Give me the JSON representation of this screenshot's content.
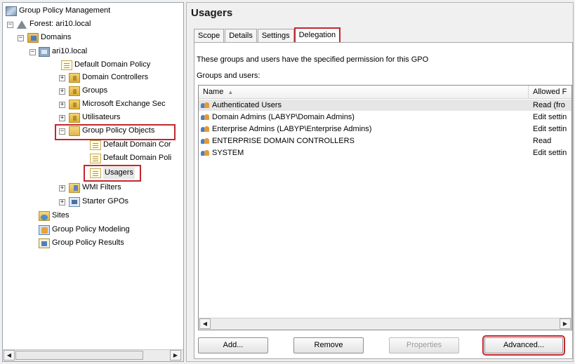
{
  "tree": {
    "items": [
      {
        "label": "Group Policy Management",
        "icon": "gpm-icon",
        "expander": ""
      },
      {
        "label": "Forest: ari10.local",
        "icon": "forest-icon",
        "expander": "−"
      },
      {
        "label": "Domains",
        "icon": "domains-icon",
        "expander": "−"
      },
      {
        "label": "ari10.local",
        "icon": "domain-icon",
        "expander": "−"
      },
      {
        "label": "Default Domain Policy",
        "icon": "gpo-link-icon",
        "expander": ""
      },
      {
        "label": "Domain Controllers",
        "icon": "ou-icon",
        "expander": "+"
      },
      {
        "label": "Groups",
        "icon": "ou-icon",
        "expander": "+"
      },
      {
        "label": "Microsoft Exchange Sec",
        "icon": "ou-icon",
        "expander": "+"
      },
      {
        "label": "Utilisateurs",
        "icon": "ou-icon",
        "expander": "+"
      },
      {
        "label": "Group Policy Objects",
        "icon": "folder-icon",
        "expander": "−"
      },
      {
        "label": "Default Domain Cor",
        "icon": "gpo-icon",
        "expander": ""
      },
      {
        "label": "Default Domain Poli",
        "icon": "gpo-icon",
        "expander": ""
      },
      {
        "label": "Usagers",
        "icon": "gpo-icon",
        "expander": ""
      },
      {
        "label": "WMI Filters",
        "icon": "wmi-filter-icon",
        "expander": "+"
      },
      {
        "label": "Starter GPOs",
        "icon": "starter-gpo-icon",
        "expander": "+"
      },
      {
        "label": "Sites",
        "icon": "sites-icon",
        "expander": ""
      },
      {
        "label": "Group Policy Modeling",
        "icon": "modeling-icon",
        "expander": ""
      },
      {
        "label": "Group Policy Results",
        "icon": "results-icon",
        "expander": ""
      }
    ]
  },
  "gpo": {
    "title": "Usagers",
    "tabs": [
      "Scope",
      "Details",
      "Settings",
      "Delegation"
    ],
    "active_tab": "Delegation",
    "description": "These groups and users have the specified permission for this GPO",
    "groups_label": "Groups and users:",
    "columns": [
      "Name",
      "Allowed F"
    ],
    "rows": [
      {
        "name": "Authenticated Users",
        "allowed": "Read (fro"
      },
      {
        "name": "Domain Admins (LABYP\\Domain Admins)",
        "allowed": "Edit settin"
      },
      {
        "name": "Enterprise Admins (LABYP\\Enterprise Admins)",
        "allowed": "Edit settin"
      },
      {
        "name": "ENTERPRISE DOMAIN CONTROLLERS",
        "allowed": "Read"
      },
      {
        "name": "SYSTEM",
        "allowed": "Edit settin"
      }
    ],
    "buttons": {
      "add": "Add...",
      "remove": "Remove",
      "properties": "Properties",
      "advanced": "Advanced..."
    }
  },
  "colors": {
    "highlight": "#c3272d",
    "selection": "#e6e6e6"
  }
}
